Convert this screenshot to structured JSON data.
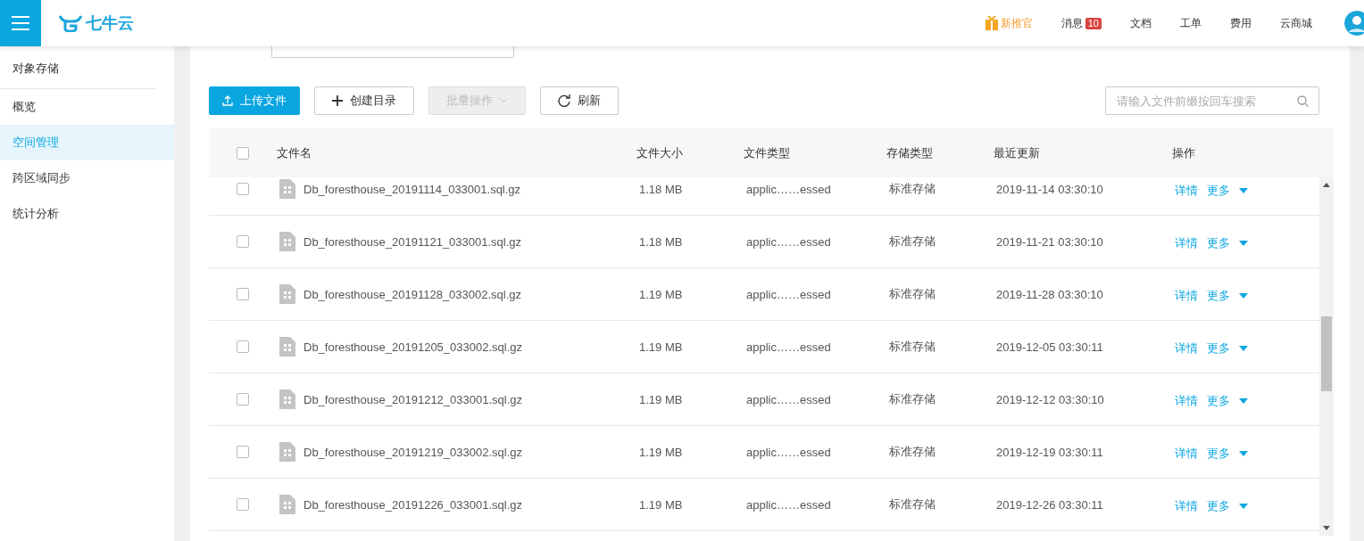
{
  "header": {
    "brand": "七牛云",
    "nav": [
      {
        "label": "新推官",
        "kind": "gift"
      },
      {
        "label": "消息",
        "kind": "badge",
        "badge": "10"
      },
      {
        "label": "文档",
        "kind": "plain"
      },
      {
        "label": "工单",
        "kind": "plain"
      },
      {
        "label": "费用",
        "kind": "plain"
      },
      {
        "label": "云商城",
        "kind": "plain"
      }
    ]
  },
  "sidebar": {
    "title": "对象存储",
    "items": [
      {
        "label": "概览",
        "selected": false
      },
      {
        "label": "空间管理",
        "selected": true
      },
      {
        "label": "跨区域同步",
        "selected": false
      },
      {
        "label": "统计分析",
        "selected": false
      }
    ]
  },
  "toolbar": {
    "buttons": [
      {
        "label": "上传文件",
        "kind": "primary",
        "disabled": false
      },
      {
        "label": "创建目录",
        "kind": "plus",
        "disabled": false
      },
      {
        "label": "批量操作",
        "kind": "dropdown",
        "disabled": true
      },
      {
        "label": "刷新",
        "kind": "refresh",
        "disabled": false
      }
    ],
    "search": {
      "placeholder": "请输入文件前缀按回车搜索"
    }
  },
  "table": {
    "columns": [
      "文件名",
      "文件大小",
      "文件类型",
      "存储类型",
      "最近更新",
      "操作"
    ],
    "rows": [
      {
        "checked": false,
        "name": "Db_foresthouse_20191114_033001.sql.gz",
        "size": "1.18 MB",
        "type": "applic……essed",
        "storage": "标准存储",
        "updated": "2019-11-14 03:30:10",
        "actions": [
          "详情",
          "更多"
        ]
      },
      {
        "checked": false,
        "name": "Db_foresthouse_20191121_033001.sql.gz",
        "size": "1.18 MB",
        "type": "applic……essed",
        "storage": "标准存储",
        "updated": "2019-11-21 03:30:10",
        "actions": [
          "详情",
          "更多"
        ]
      },
      {
        "checked": false,
        "name": "Db_foresthouse_20191128_033002.sql.gz",
        "size": "1.19 MB",
        "type": "applic……essed",
        "storage": "标准存储",
        "updated": "2019-11-28 03:30:10",
        "actions": [
          "详情",
          "更多"
        ]
      },
      {
        "checked": false,
        "name": "Db_foresthouse_20191205_033002.sql.gz",
        "size": "1.19 MB",
        "type": "applic……essed",
        "storage": "标准存储",
        "updated": "2019-12-05 03:30:11",
        "actions": [
          "详情",
          "更多"
        ]
      },
      {
        "checked": false,
        "name": "Db_foresthouse_20191212_033001.sql.gz",
        "size": "1.19 MB",
        "type": "applic……essed",
        "storage": "标准存储",
        "updated": "2019-12-12 03:30:10",
        "actions": [
          "详情",
          "更多"
        ]
      },
      {
        "checked": false,
        "name": "Db_foresthouse_20191219_033002.sql.gz",
        "size": "1.19 MB",
        "type": "applic……essed",
        "storage": "标准存储",
        "updated": "2019-12-19 03:30:11",
        "actions": [
          "详情",
          "更多"
        ]
      },
      {
        "checked": false,
        "name": "Db_foresthouse_20191226_033001.sql.gz",
        "size": "1.19 MB",
        "type": "applic……essed",
        "storage": "标准存储",
        "updated": "2019-12-26 03:30:11",
        "actions": [
          "详情",
          "更多"
        ]
      }
    ],
    "all_checked": false
  }
}
